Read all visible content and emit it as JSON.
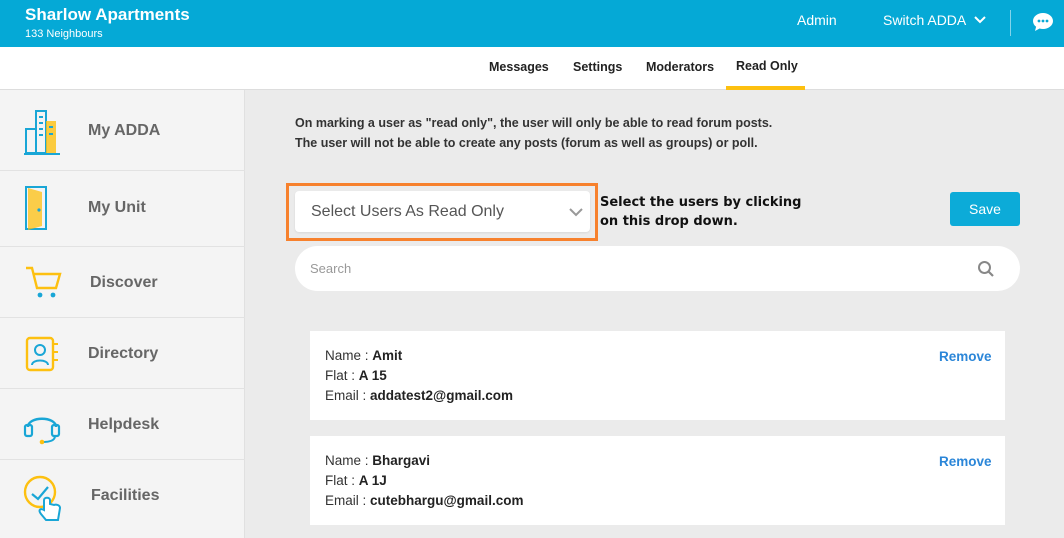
{
  "header": {
    "community_name": "Sharlow Apartments",
    "neighbours": "133 Neighbours",
    "admin_label": "Admin",
    "switch_label": "Switch ADDA",
    "brand_color": "#05a9d6"
  },
  "tabs": [
    {
      "label": "Messages"
    },
    {
      "label": "Settings"
    },
    {
      "label": "Moderators"
    },
    {
      "label": "Read Only",
      "active": true
    }
  ],
  "sidebar": {
    "items": [
      {
        "label": "My ADDA",
        "icon": "building-icon"
      },
      {
        "label": "My Unit",
        "icon": "door-icon"
      },
      {
        "label": "Discover",
        "icon": "cart-icon"
      },
      {
        "label": "Directory",
        "icon": "contacts-book-icon"
      },
      {
        "label": "Helpdesk",
        "icon": "headset-icon"
      },
      {
        "label": "Facilities",
        "icon": "tap-hand-icon"
      }
    ]
  },
  "main": {
    "info_line1": "On marking a user as \"read only\", the user will only be able to read forum posts.",
    "info_line2": "The user will not be able to create any posts (forum as well as groups) or poll.",
    "select_value": "Select Users As Read Only",
    "hint_line1": "Select the users by clicking",
    "hint_line2": "on this drop down.",
    "save_label": "Save",
    "search_placeholder": "Search",
    "highlight_color": "#f7812d",
    "accent_color": "#fdc010"
  },
  "users": [
    {
      "name_label": "Name : ",
      "name": "Amit",
      "flat_label": "Flat : ",
      "flat": "A 15",
      "email_label": "Email : ",
      "email": "addatest2@gmail.com",
      "remove_label": "Remove"
    },
    {
      "name_label": "Name : ",
      "name": "Bhargavi",
      "flat_label": "Flat : ",
      "flat": "A 1J",
      "email_label": "Email : ",
      "email": "cutebhargu@gmail.com",
      "remove_label": "Remove"
    }
  ]
}
